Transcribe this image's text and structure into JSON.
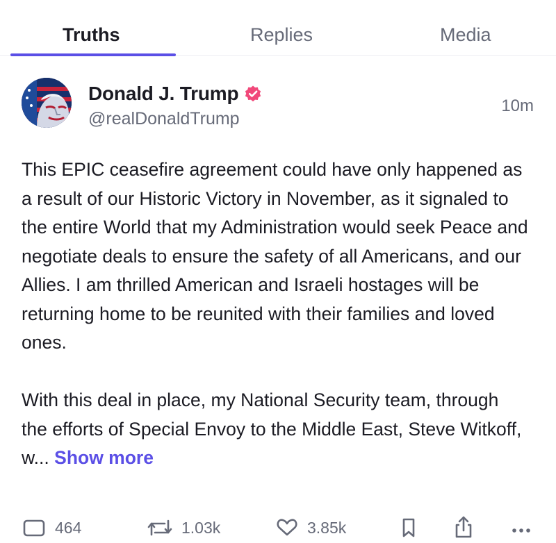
{
  "tabs": [
    {
      "label": "Truths",
      "active": true
    },
    {
      "label": "Replies",
      "active": false
    },
    {
      "label": "Media",
      "active": false
    }
  ],
  "post": {
    "author": {
      "display_name": "Donald J. Trump",
      "handle": "@realDonaldTrump",
      "verified": true,
      "verified_color": "#f1487a"
    },
    "timestamp": "10m",
    "paragraphs": [
      "This EPIC ceasefire agreement could have only happened as a result of our Historic Victory in November, as it signaled to the entire World that my Administration would seek Peace and negotiate deals to ensure the safety of all Americans, and our Allies. I am thrilled American and Israeli hostages will be returning home to be reunited with their families and loved ones.",
      "With this deal in place, my National Security team, through the efforts of Special Envoy to the Middle East, Steve Witkoff, w..."
    ],
    "show_more_label": "Show more",
    "actions": {
      "replies": "464",
      "retruths": "1.03k",
      "likes": "3.85k"
    }
  },
  "colors": {
    "accent": "#5b4fe6",
    "text_primary": "#1b1b23",
    "text_secondary": "#666a78"
  },
  "icons": {
    "reply": "reply-icon",
    "retruth": "retruth-icon",
    "like": "heart-icon",
    "bookmark": "bookmark-icon",
    "share": "share-icon",
    "more": "more-icon"
  }
}
